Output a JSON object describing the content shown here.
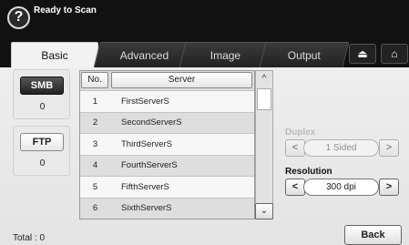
{
  "header": {
    "title": "Ready to Scan",
    "help_icon": "?"
  },
  "tabs": [
    {
      "label": "Basic",
      "active": true
    },
    {
      "label": "Advanced",
      "active": false
    },
    {
      "label": "Image",
      "active": false
    },
    {
      "label": "Output",
      "active": false
    }
  ],
  "toolbar": {
    "upload_icon": "⏏",
    "home_icon": "⌂"
  },
  "categories": [
    {
      "label": "SMB",
      "count": "0",
      "selected": true
    },
    {
      "label": "FTP",
      "count": "0",
      "selected": false
    }
  ],
  "table": {
    "columns": [
      "No.",
      "Server"
    ],
    "rows": [
      {
        "no": "1",
        "server": "FirstServerS"
      },
      {
        "no": "2",
        "server": "SecondServerS"
      },
      {
        "no": "3",
        "server": "ThirdServerS"
      },
      {
        "no": "4",
        "server": "FourthServerS"
      },
      {
        "no": "5",
        "server": "FifthServerS"
      },
      {
        "no": "6",
        "server": "SixthServerS"
      }
    ],
    "scroll_up_icon": "^",
    "scroll_down_icon": "⌄"
  },
  "duplex": {
    "label": "Duplex",
    "value": "1 Sided",
    "enabled": false
  },
  "resolution": {
    "label": "Resolution",
    "value": "300 dpi"
  },
  "footer": {
    "total_label": "Total : 0",
    "back_label": "Back"
  }
}
